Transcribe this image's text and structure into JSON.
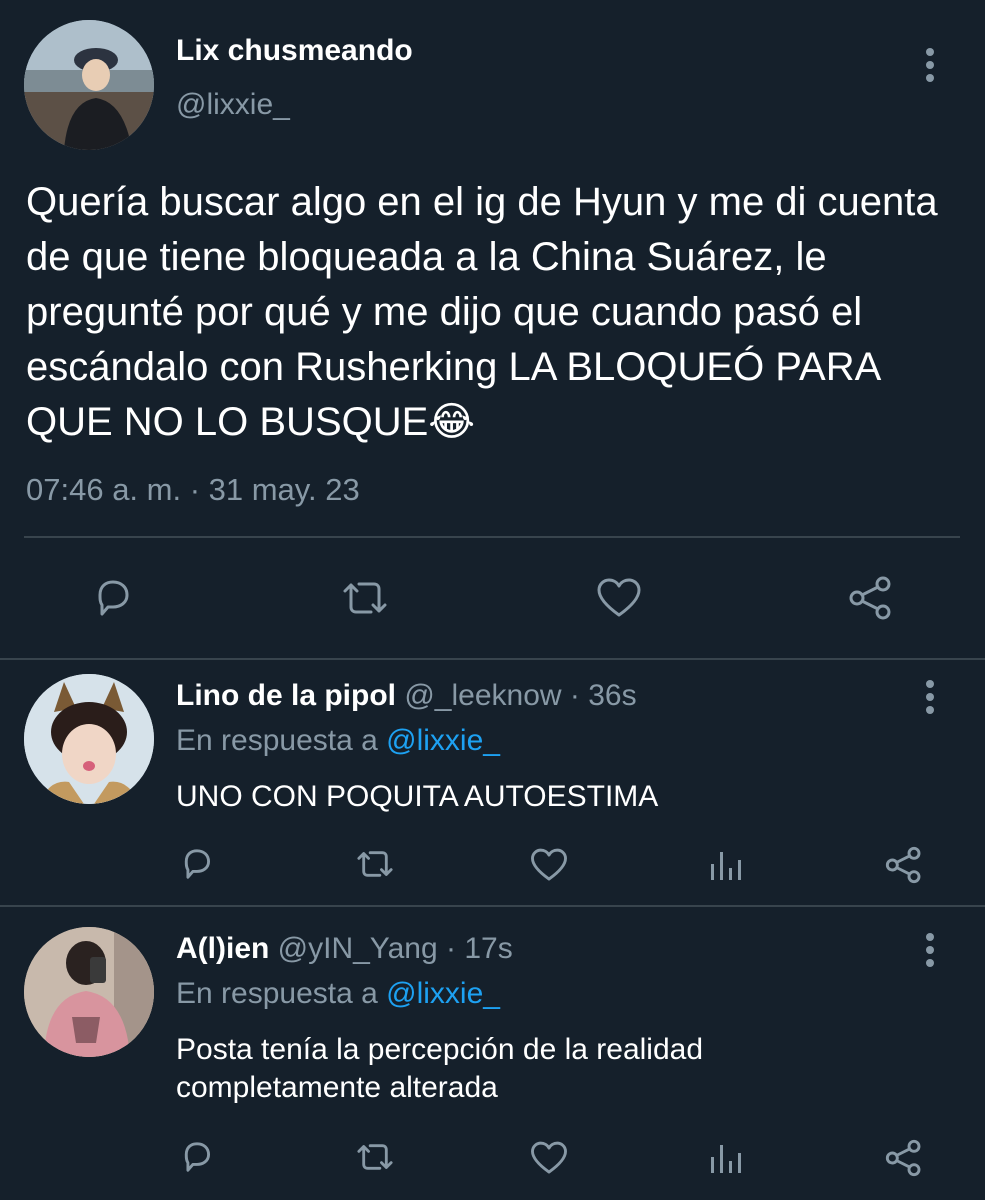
{
  "main_tweet": {
    "display_name": "Lix chusmeando",
    "handle": "@lixxie_",
    "text": "Quería buscar algo en el ig de Hyun y me di cuenta de que tiene bloqueada a la China Suárez, le pregunté por qué y me dijo que cuando pasó el escándalo con Rusherking LA BLOQUEÓ PARA QUE NO LO BUSQUE😂",
    "timestamp": "07:46 a. m. · 31 may. 23"
  },
  "replies": [
    {
      "display_name": "Lino de la pipol",
      "handle": "@_leeknow",
      "time": "· 36s",
      "reply_prefix": "En respuesta a",
      "reply_to": "@lixxie_",
      "text": "UNO CON POQUITA AUTOESTIMA"
    },
    {
      "display_name": "A(l)ien",
      "handle": "@yIN_Yang",
      "time": "· 17s",
      "reply_prefix": "En respuesta a",
      "reply_to": "@lixxie_",
      "text": "Posta tenía la percepción de la realidad completamente alterada"
    }
  ],
  "icons": {
    "reply": "reply-icon",
    "retweet": "retweet-icon",
    "like": "heart-icon",
    "share": "share-icon",
    "analytics": "analytics-icon",
    "more": "more-vertical-icon"
  },
  "colors": {
    "background": "#15202b",
    "muted": "#8899a6",
    "link": "#1da1f2",
    "divider": "#38444d"
  }
}
